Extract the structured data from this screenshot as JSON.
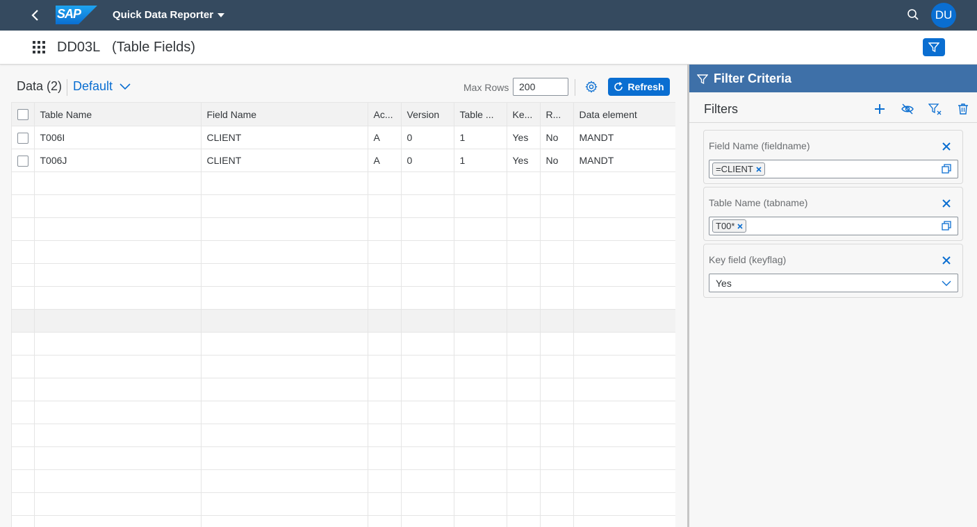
{
  "shell": {
    "logo": "SAP",
    "app_title": "Quick Data Reporter",
    "avatar_initials": "DU"
  },
  "header": {
    "table_id": "DD03L",
    "table_desc": "(Table Fields)"
  },
  "toolbar": {
    "data_title": "Data (2)",
    "variant": "Default",
    "max_rows_label": "Max Rows",
    "max_rows_value": "200",
    "refresh_label": "Refresh"
  },
  "table": {
    "columns": [
      "Table Name",
      "Field Name",
      "Ac...",
      "Version",
      "Table ...",
      "Ke...",
      "R...",
      "Data element"
    ],
    "rows": [
      [
        "T006I",
        "CLIENT",
        "A",
        "0",
        "1",
        "Yes",
        "No",
        "MANDT"
      ],
      [
        "T006J",
        "CLIENT",
        "A",
        "0",
        "1",
        "Yes",
        "No",
        "MANDT"
      ]
    ]
  },
  "panel": {
    "title": "Filter Criteria",
    "filters_title": "Filters",
    "cards": [
      {
        "label": "Field Name (fieldname)",
        "token": "=CLIENT"
      },
      {
        "label": "Table Name (tabname)",
        "token": "T00*"
      },
      {
        "label": "Key field (keyflag)",
        "selected": "Yes"
      }
    ]
  },
  "colors": {
    "shell_bg": "#354a5f",
    "accent": "#0a6ed1",
    "panel_header": "#3e70a8"
  }
}
